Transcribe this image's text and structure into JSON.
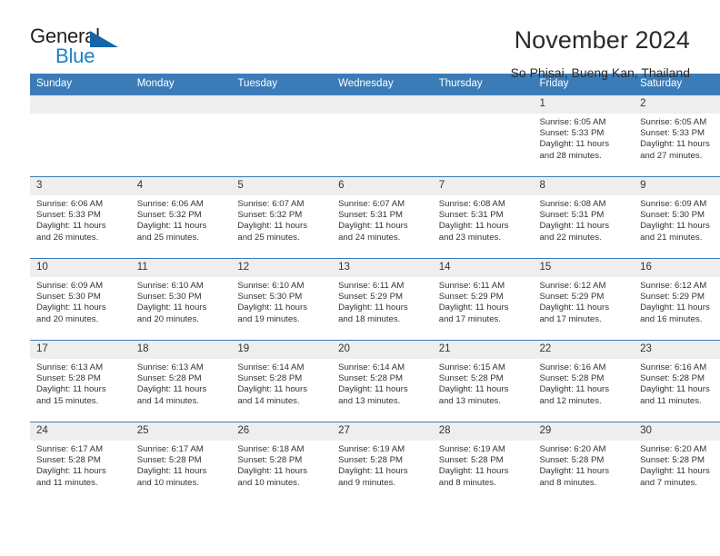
{
  "brand": {
    "name_dark": "General",
    "name_blue": "Blue",
    "accent_color": "#1f7fc4",
    "triangle_color": "#1565a8"
  },
  "header": {
    "title": "November 2024",
    "subtitle": "So Phisai, Bueng Kan, Thailand"
  },
  "calendar": {
    "header_bg": "#3b7cb8",
    "daynum_bg": "#eeeeee",
    "weekdays": [
      "Sunday",
      "Monday",
      "Tuesday",
      "Wednesday",
      "Thursday",
      "Friday",
      "Saturday"
    ],
    "weeks": [
      [
        {
          "day": "",
          "sunrise": "",
          "sunset": "",
          "daylight_line1": "",
          "daylight_line2": ""
        },
        {
          "day": "",
          "sunrise": "",
          "sunset": "",
          "daylight_line1": "",
          "daylight_line2": ""
        },
        {
          "day": "",
          "sunrise": "",
          "sunset": "",
          "daylight_line1": "",
          "daylight_line2": ""
        },
        {
          "day": "",
          "sunrise": "",
          "sunset": "",
          "daylight_line1": "",
          "daylight_line2": ""
        },
        {
          "day": "",
          "sunrise": "",
          "sunset": "",
          "daylight_line1": "",
          "daylight_line2": ""
        },
        {
          "day": "1",
          "sunrise": "Sunrise: 6:05 AM",
          "sunset": "Sunset: 5:33 PM",
          "daylight_line1": "Daylight: 11 hours",
          "daylight_line2": "and 28 minutes."
        },
        {
          "day": "2",
          "sunrise": "Sunrise: 6:05 AM",
          "sunset": "Sunset: 5:33 PM",
          "daylight_line1": "Daylight: 11 hours",
          "daylight_line2": "and 27 minutes."
        }
      ],
      [
        {
          "day": "3",
          "sunrise": "Sunrise: 6:06 AM",
          "sunset": "Sunset: 5:33 PM",
          "daylight_line1": "Daylight: 11 hours",
          "daylight_line2": "and 26 minutes."
        },
        {
          "day": "4",
          "sunrise": "Sunrise: 6:06 AM",
          "sunset": "Sunset: 5:32 PM",
          "daylight_line1": "Daylight: 11 hours",
          "daylight_line2": "and 25 minutes."
        },
        {
          "day": "5",
          "sunrise": "Sunrise: 6:07 AM",
          "sunset": "Sunset: 5:32 PM",
          "daylight_line1": "Daylight: 11 hours",
          "daylight_line2": "and 25 minutes."
        },
        {
          "day": "6",
          "sunrise": "Sunrise: 6:07 AM",
          "sunset": "Sunset: 5:31 PM",
          "daylight_line1": "Daylight: 11 hours",
          "daylight_line2": "and 24 minutes."
        },
        {
          "day": "7",
          "sunrise": "Sunrise: 6:08 AM",
          "sunset": "Sunset: 5:31 PM",
          "daylight_line1": "Daylight: 11 hours",
          "daylight_line2": "and 23 minutes."
        },
        {
          "day": "8",
          "sunrise": "Sunrise: 6:08 AM",
          "sunset": "Sunset: 5:31 PM",
          "daylight_line1": "Daylight: 11 hours",
          "daylight_line2": "and 22 minutes."
        },
        {
          "day": "9",
          "sunrise": "Sunrise: 6:09 AM",
          "sunset": "Sunset: 5:30 PM",
          "daylight_line1": "Daylight: 11 hours",
          "daylight_line2": "and 21 minutes."
        }
      ],
      [
        {
          "day": "10",
          "sunrise": "Sunrise: 6:09 AM",
          "sunset": "Sunset: 5:30 PM",
          "daylight_line1": "Daylight: 11 hours",
          "daylight_line2": "and 20 minutes."
        },
        {
          "day": "11",
          "sunrise": "Sunrise: 6:10 AM",
          "sunset": "Sunset: 5:30 PM",
          "daylight_line1": "Daylight: 11 hours",
          "daylight_line2": "and 20 minutes."
        },
        {
          "day": "12",
          "sunrise": "Sunrise: 6:10 AM",
          "sunset": "Sunset: 5:30 PM",
          "daylight_line1": "Daylight: 11 hours",
          "daylight_line2": "and 19 minutes."
        },
        {
          "day": "13",
          "sunrise": "Sunrise: 6:11 AM",
          "sunset": "Sunset: 5:29 PM",
          "daylight_line1": "Daylight: 11 hours",
          "daylight_line2": "and 18 minutes."
        },
        {
          "day": "14",
          "sunrise": "Sunrise: 6:11 AM",
          "sunset": "Sunset: 5:29 PM",
          "daylight_line1": "Daylight: 11 hours",
          "daylight_line2": "and 17 minutes."
        },
        {
          "day": "15",
          "sunrise": "Sunrise: 6:12 AM",
          "sunset": "Sunset: 5:29 PM",
          "daylight_line1": "Daylight: 11 hours",
          "daylight_line2": "and 17 minutes."
        },
        {
          "day": "16",
          "sunrise": "Sunrise: 6:12 AM",
          "sunset": "Sunset: 5:29 PM",
          "daylight_line1": "Daylight: 11 hours",
          "daylight_line2": "and 16 minutes."
        }
      ],
      [
        {
          "day": "17",
          "sunrise": "Sunrise: 6:13 AM",
          "sunset": "Sunset: 5:28 PM",
          "daylight_line1": "Daylight: 11 hours",
          "daylight_line2": "and 15 minutes."
        },
        {
          "day": "18",
          "sunrise": "Sunrise: 6:13 AM",
          "sunset": "Sunset: 5:28 PM",
          "daylight_line1": "Daylight: 11 hours",
          "daylight_line2": "and 14 minutes."
        },
        {
          "day": "19",
          "sunrise": "Sunrise: 6:14 AM",
          "sunset": "Sunset: 5:28 PM",
          "daylight_line1": "Daylight: 11 hours",
          "daylight_line2": "and 14 minutes."
        },
        {
          "day": "20",
          "sunrise": "Sunrise: 6:14 AM",
          "sunset": "Sunset: 5:28 PM",
          "daylight_line1": "Daylight: 11 hours",
          "daylight_line2": "and 13 minutes."
        },
        {
          "day": "21",
          "sunrise": "Sunrise: 6:15 AM",
          "sunset": "Sunset: 5:28 PM",
          "daylight_line1": "Daylight: 11 hours",
          "daylight_line2": "and 13 minutes."
        },
        {
          "day": "22",
          "sunrise": "Sunrise: 6:16 AM",
          "sunset": "Sunset: 5:28 PM",
          "daylight_line1": "Daylight: 11 hours",
          "daylight_line2": "and 12 minutes."
        },
        {
          "day": "23",
          "sunrise": "Sunrise: 6:16 AM",
          "sunset": "Sunset: 5:28 PM",
          "daylight_line1": "Daylight: 11 hours",
          "daylight_line2": "and 11 minutes."
        }
      ],
      [
        {
          "day": "24",
          "sunrise": "Sunrise: 6:17 AM",
          "sunset": "Sunset: 5:28 PM",
          "daylight_line1": "Daylight: 11 hours",
          "daylight_line2": "and 11 minutes."
        },
        {
          "day": "25",
          "sunrise": "Sunrise: 6:17 AM",
          "sunset": "Sunset: 5:28 PM",
          "daylight_line1": "Daylight: 11 hours",
          "daylight_line2": "and 10 minutes."
        },
        {
          "day": "26",
          "sunrise": "Sunrise: 6:18 AM",
          "sunset": "Sunset: 5:28 PM",
          "daylight_line1": "Daylight: 11 hours",
          "daylight_line2": "and 10 minutes."
        },
        {
          "day": "27",
          "sunrise": "Sunrise: 6:19 AM",
          "sunset": "Sunset: 5:28 PM",
          "daylight_line1": "Daylight: 11 hours",
          "daylight_line2": "and 9 minutes."
        },
        {
          "day": "28",
          "sunrise": "Sunrise: 6:19 AM",
          "sunset": "Sunset: 5:28 PM",
          "daylight_line1": "Daylight: 11 hours",
          "daylight_line2": "and 8 minutes."
        },
        {
          "day": "29",
          "sunrise": "Sunrise: 6:20 AM",
          "sunset": "Sunset: 5:28 PM",
          "daylight_line1": "Daylight: 11 hours",
          "daylight_line2": "and 8 minutes."
        },
        {
          "day": "30",
          "sunrise": "Sunrise: 6:20 AM",
          "sunset": "Sunset: 5:28 PM",
          "daylight_line1": "Daylight: 11 hours",
          "daylight_line2": "and 7 minutes."
        }
      ]
    ]
  }
}
